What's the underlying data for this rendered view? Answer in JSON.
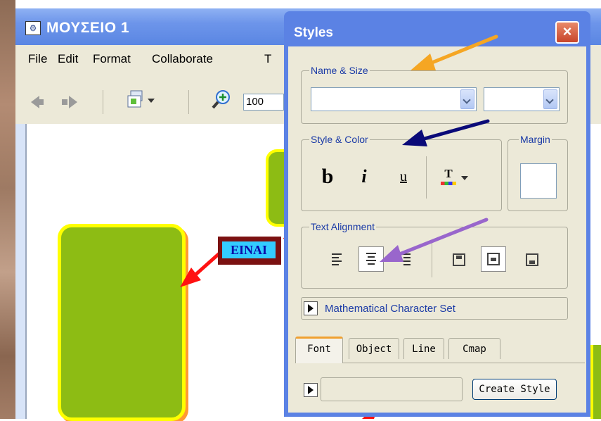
{
  "main_window": {
    "title": "ΜΟΥΣΕΙΟ 1",
    "menus": [
      "File",
      "Edit",
      "Format",
      "Collaborate",
      "T"
    ],
    "zoom_value": "100"
  },
  "canvas": {
    "link_label": "ΕΙΝΑΙ",
    "colors": {
      "node_fill": "#8dbc14",
      "node_border": "#ffff00",
      "link_arrow": "#ff1111",
      "link_bg": "#33ccff"
    }
  },
  "styles_dialog": {
    "title": "Styles",
    "close_symbol": "×",
    "name_size": {
      "label": "Name & Size",
      "font_name_value": "",
      "font_size_value": ""
    },
    "style_color": {
      "label": "Style & Color",
      "bold": "b",
      "italic": "i",
      "underline": "u",
      "color_glyph": "T"
    },
    "margin": {
      "label": "Margin"
    },
    "text_alignment": {
      "label": "Text Alignment",
      "pressed": [
        "align-center",
        "valign-middle"
      ]
    },
    "math_charset": {
      "label": "Mathematical Character Set"
    },
    "tabs": [
      {
        "label": "Font",
        "active": true
      },
      {
        "label": "Object",
        "active": false
      },
      {
        "label": "Line",
        "active": false
      },
      {
        "label": "Cmap",
        "active": false
      }
    ],
    "style_name_value": "",
    "create_button": "Create Style"
  },
  "annotations": {
    "arrow_colors": [
      "#f5a623",
      "#0a0a78",
      "#9966cc"
    ]
  },
  "icons": [
    "app-icon",
    "back-arrow-icon",
    "forward-arrow-icon",
    "view-icon",
    "zoom-in-icon",
    "text-color-icon",
    "align-left-icon",
    "align-center-icon",
    "align-right-icon",
    "valign-top-icon",
    "valign-middle-icon",
    "valign-bottom-icon",
    "expand-triangle-icon"
  ]
}
